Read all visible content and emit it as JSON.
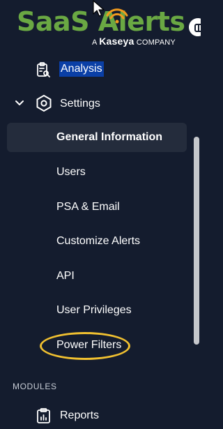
{
  "brand": {
    "logo_main": "SaaS Alerts",
    "sub_prefix": "A",
    "sub_company": "Kaseya",
    "sub_suffix": "COMPANY",
    "logo_color": "#6aa843",
    "wifi_color": "#f29a1e"
  },
  "nav": {
    "analysis": {
      "label": "Analysis",
      "icon": "clipboard-search-icon",
      "selected_text_bg": "#0a3fa6"
    },
    "settings": {
      "label": "Settings",
      "icon": "gear-hexagon-icon",
      "expanded": true
    },
    "settings_items": [
      {
        "label": "General Information",
        "active": true
      },
      {
        "label": "Users"
      },
      {
        "label": "PSA & Email"
      },
      {
        "label": "Customize Alerts"
      },
      {
        "label": "API"
      },
      {
        "label": "User Privileges"
      },
      {
        "label": "Power Filters",
        "highlighted": true
      }
    ],
    "modules_header": "MODULES",
    "reports": {
      "label": "Reports",
      "icon": "clipboard-chart-icon"
    }
  },
  "colors": {
    "background": "#141c2e",
    "active_item_bg": "#242c3c",
    "highlight_oval": "#f0c030"
  }
}
